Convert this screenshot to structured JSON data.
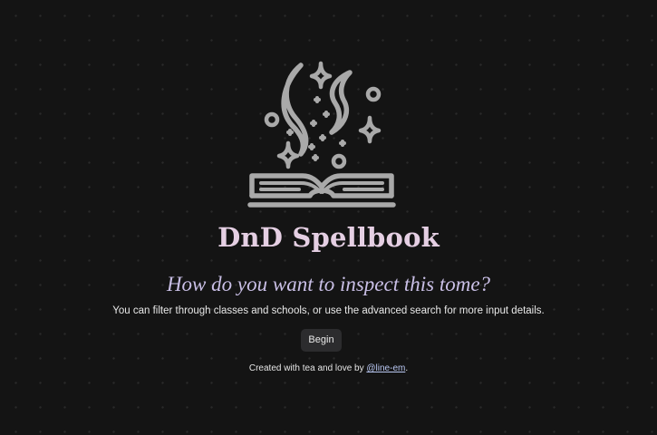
{
  "hero": {
    "logo_icon": "spellbook-icon",
    "title": "DnD Spellbook",
    "subtitle": "How do you want to inspect this tome?",
    "description": "You can filter through classes and schools, or use the advanced search for more input details.",
    "begin_label": "Begin"
  },
  "footer": {
    "prefix": "Created with tea and love by ",
    "author_link": "@line-em",
    "suffix": "."
  },
  "colors": {
    "background": "#141414",
    "title": "#e5cfe3",
    "subtitle": "#c9bfe6",
    "icon": "#a9a9a9",
    "button_bg": "#2c2c2e",
    "link": "#b9c7f2"
  }
}
